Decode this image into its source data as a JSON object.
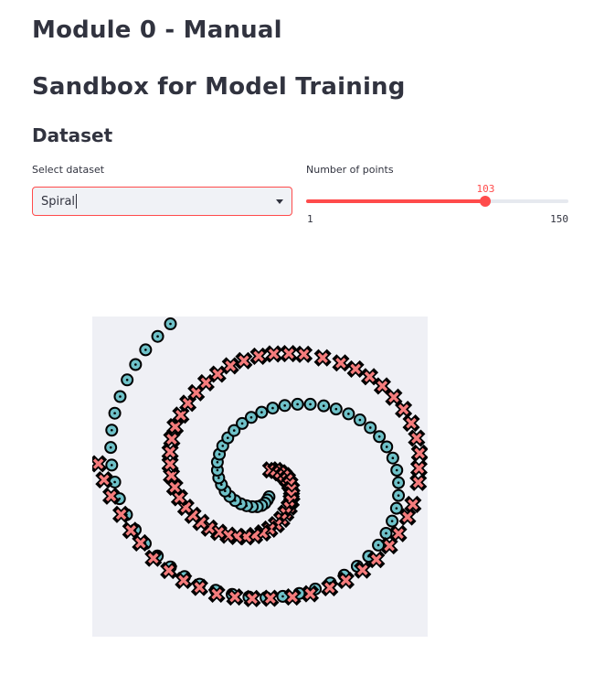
{
  "page": {
    "title": "Module 0 - Manual",
    "subtitle": "Sandbox for Model Training",
    "section": "Dataset"
  },
  "dataset_select": {
    "label": "Select dataset",
    "value": "Spiral"
  },
  "points_slider": {
    "label": "Number of points",
    "min": 1,
    "max": 150,
    "value": 103,
    "min_label": "1",
    "max_label": "150",
    "value_label": "103"
  },
  "colors": {
    "accent": "#ff4b4b",
    "class_circle": "#6ec1c8",
    "class_cross": "#f47c7c",
    "plot_background": "#eff0f5"
  },
  "chart_data": {
    "type": "scatter",
    "title": "",
    "xlabel": "",
    "ylabel": "",
    "xlim": [
      0,
      1
    ],
    "ylim": [
      0,
      1
    ],
    "grid": false,
    "legend": "none",
    "series": [
      {
        "marker": "circle",
        "points": [
          [
            0.527,
            0.563
          ],
          [
            0.522,
            0.573
          ],
          [
            0.515,
            0.583
          ],
          [
            0.505,
            0.59
          ],
          [
            0.492,
            0.594
          ],
          [
            0.477,
            0.594
          ],
          [
            0.46,
            0.591
          ],
          [
            0.443,
            0.585
          ],
          [
            0.426,
            0.575
          ],
          [
            0.41,
            0.562
          ],
          [
            0.396,
            0.545
          ],
          [
            0.385,
            0.525
          ],
          [
            0.377,
            0.504
          ],
          [
            0.373,
            0.48
          ],
          [
            0.373,
            0.455
          ],
          [
            0.379,
            0.43
          ],
          [
            0.389,
            0.404
          ],
          [
            0.404,
            0.379
          ],
          [
            0.423,
            0.356
          ],
          [
            0.447,
            0.334
          ],
          [
            0.474,
            0.315
          ],
          [
            0.505,
            0.299
          ],
          [
            0.538,
            0.286
          ],
          [
            0.574,
            0.278
          ],
          [
            0.612,
            0.274
          ],
          [
            0.65,
            0.274
          ],
          [
            0.69,
            0.279
          ],
          [
            0.727,
            0.289
          ],
          [
            0.764,
            0.304
          ],
          [
            0.798,
            0.323
          ],
          [
            0.829,
            0.347
          ],
          [
            0.856,
            0.375
          ],
          [
            0.878,
            0.407
          ],
          [
            0.896,
            0.442
          ],
          [
            0.908,
            0.48
          ],
          [
            0.913,
            0.519
          ],
          [
            0.913,
            0.559
          ],
          [
            0.907,
            0.599
          ],
          [
            0.894,
            0.639
          ],
          [
            0.876,
            0.677
          ],
          [
            0.853,
            0.714
          ],
          [
            0.824,
            0.749
          ],
          [
            0.79,
            0.78
          ],
          [
            0.751,
            0.808
          ],
          [
            0.71,
            0.832
          ],
          [
            0.665,
            0.851
          ],
          [
            0.617,
            0.865
          ],
          [
            0.568,
            0.874
          ],
          [
            0.518,
            0.878
          ],
          [
            0.467,
            0.876
          ],
          [
            0.417,
            0.868
          ],
          [
            0.368,
            0.855
          ],
          [
            0.32,
            0.836
          ],
          [
            0.275,
            0.812
          ],
          [
            0.233,
            0.782
          ],
          [
            0.194,
            0.748
          ],
          [
            0.158,
            0.709
          ],
          [
            0.128,
            0.666
          ],
          [
            0.102,
            0.619
          ],
          [
            0.081,
            0.569
          ],
          [
            0.067,
            0.517
          ],
          [
            0.058,
            0.464
          ],
          [
            0.055,
            0.409
          ],
          [
            0.058,
            0.355
          ],
          [
            0.067,
            0.302
          ],
          [
            0.083,
            0.25
          ],
          [
            0.104,
            0.198
          ],
          [
            0.129,
            0.15
          ],
          [
            0.159,
            0.104
          ],
          [
            0.195,
            0.062
          ],
          [
            0.233,
            0.023
          ]
        ]
      },
      {
        "marker": "cross",
        "points": [
          [
            0.532,
            0.479
          ],
          [
            0.547,
            0.481
          ],
          [
            0.56,
            0.488
          ],
          [
            0.572,
            0.497
          ],
          [
            0.582,
            0.509
          ],
          [
            0.589,
            0.523
          ],
          [
            0.594,
            0.54
          ],
          [
            0.595,
            0.557
          ],
          [
            0.593,
            0.575
          ],
          [
            0.587,
            0.595
          ],
          [
            0.577,
            0.614
          ],
          [
            0.565,
            0.633
          ],
          [
            0.549,
            0.65
          ],
          [
            0.529,
            0.664
          ],
          [
            0.508,
            0.676
          ],
          [
            0.484,
            0.684
          ],
          [
            0.459,
            0.688
          ],
          [
            0.431,
            0.687
          ],
          [
            0.405,
            0.683
          ],
          [
            0.377,
            0.674
          ],
          [
            0.349,
            0.661
          ],
          [
            0.324,
            0.643
          ],
          [
            0.3,
            0.621
          ],
          [
            0.279,
            0.596
          ],
          [
            0.26,
            0.566
          ],
          [
            0.246,
            0.533
          ],
          [
            0.236,
            0.497
          ],
          [
            0.232,
            0.461
          ],
          [
            0.232,
            0.423
          ],
          [
            0.237,
            0.383
          ],
          [
            0.247,
            0.344
          ],
          [
            0.264,
            0.308
          ],
          [
            0.285,
            0.271
          ],
          [
            0.31,
            0.238
          ],
          [
            0.339,
            0.207
          ],
          [
            0.374,
            0.18
          ],
          [
            0.412,
            0.154
          ],
          [
            0.452,
            0.138
          ],
          [
            0.496,
            0.124
          ],
          [
            0.541,
            0.117
          ],
          [
            0.586,
            0.116
          ],
          [
            0.631,
            0.118
          ],
          [
            0.687,
            0.129
          ],
          [
            0.741,
            0.145
          ],
          [
            0.785,
            0.164
          ],
          [
            0.827,
            0.188
          ],
          [
            0.865,
            0.217
          ],
          [
            0.899,
            0.252
          ],
          [
            0.928,
            0.29
          ],
          [
            0.951,
            0.333
          ],
          [
            0.967,
            0.38
          ],
          [
            0.976,
            0.427
          ],
          [
            0.974,
            0.474
          ],
          [
            0.972,
            0.518
          ],
          [
            0.956,
            0.587
          ],
          [
            0.94,
            0.626
          ],
          [
            0.913,
            0.678
          ],
          [
            0.886,
            0.716
          ],
          [
            0.847,
            0.759
          ],
          [
            0.806,
            0.792
          ],
          [
            0.756,
            0.824
          ],
          [
            0.708,
            0.847
          ],
          [
            0.65,
            0.866
          ],
          [
            0.597,
            0.876
          ],
          [
            0.531,
            0.88
          ],
          [
            0.477,
            0.881
          ],
          [
            0.425,
            0.876
          ],
          [
            0.371,
            0.867
          ],
          [
            0.32,
            0.846
          ],
          [
            0.272,
            0.824
          ],
          [
            0.228,
            0.793
          ],
          [
            0.182,
            0.755
          ],
          [
            0.144,
            0.707
          ],
          [
            0.115,
            0.668
          ],
          [
            0.086,
            0.618
          ],
          [
            0.056,
            0.561
          ],
          [
            0.035,
            0.51
          ],
          [
            0.018,
            0.46
          ]
        ]
      }
    ]
  }
}
